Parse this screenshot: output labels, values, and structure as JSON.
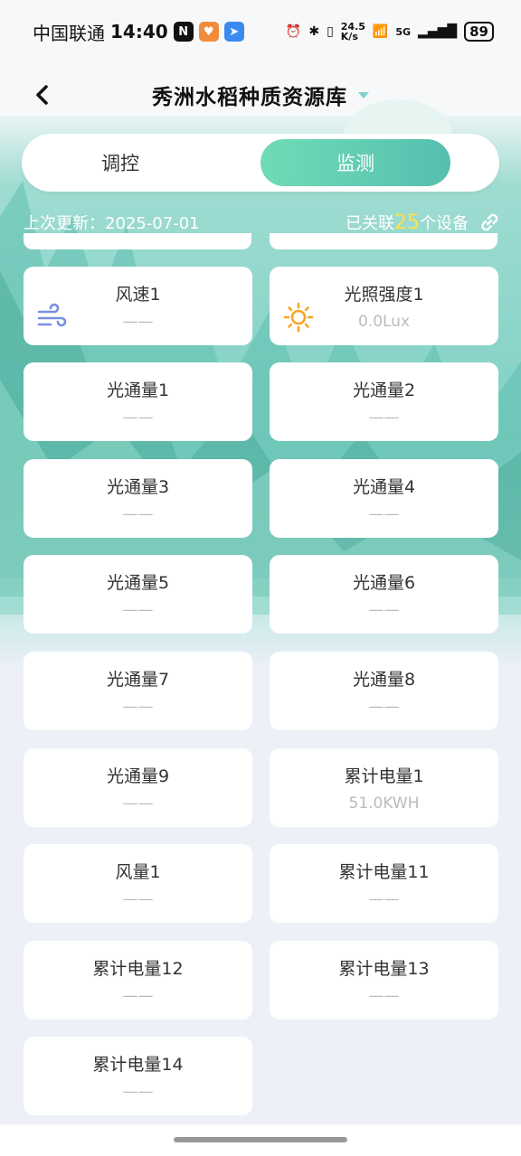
{
  "status_bar": {
    "carrier": "中国联通",
    "time": "14:40",
    "net_speed_value": "24.5",
    "net_speed_unit": "K/s",
    "signal": "5G",
    "battery": "89"
  },
  "header": {
    "title": "秀洲水稻种质资源库"
  },
  "segment": {
    "left_label": "调控",
    "right_label": "监测",
    "active": "监测"
  },
  "info": {
    "last_update": "上次更新：2025-07-01",
    "linked_prefix": "已关联",
    "linked_count": "25",
    "linked_suffix": "个设备"
  },
  "colors": {
    "accent_green": "#5ec4b2",
    "count_yellow": "#ffe14a",
    "wind_icon": "#7a8fe0",
    "sun_icon": "#f5a623"
  },
  "cards": [
    {
      "label": "风速1",
      "value": "——",
      "icon": "wind-icon"
    },
    {
      "label": "光照强度1",
      "value": "0.0Lux",
      "icon": "sun-icon"
    },
    {
      "label": "光通量1",
      "value": "——"
    },
    {
      "label": "光通量2",
      "value": "——"
    },
    {
      "label": "光通量3",
      "value": "——"
    },
    {
      "label": "光通量4",
      "value": "——"
    },
    {
      "label": "光通量5",
      "value": "——"
    },
    {
      "label": "光通量6",
      "value": "——"
    },
    {
      "label": "光通量7",
      "value": "——"
    },
    {
      "label": "光通量8",
      "value": "——"
    },
    {
      "label": "光通量9",
      "value": "——"
    },
    {
      "label": "累计电量1",
      "value": "51.0KWH"
    },
    {
      "label": "风量1",
      "value": "——"
    },
    {
      "label": "累计电量11",
      "value": "——"
    },
    {
      "label": "累计电量12",
      "value": "——"
    },
    {
      "label": "累计电量13",
      "value": "——"
    },
    {
      "label": "累计电量14",
      "value": "——"
    }
  ]
}
